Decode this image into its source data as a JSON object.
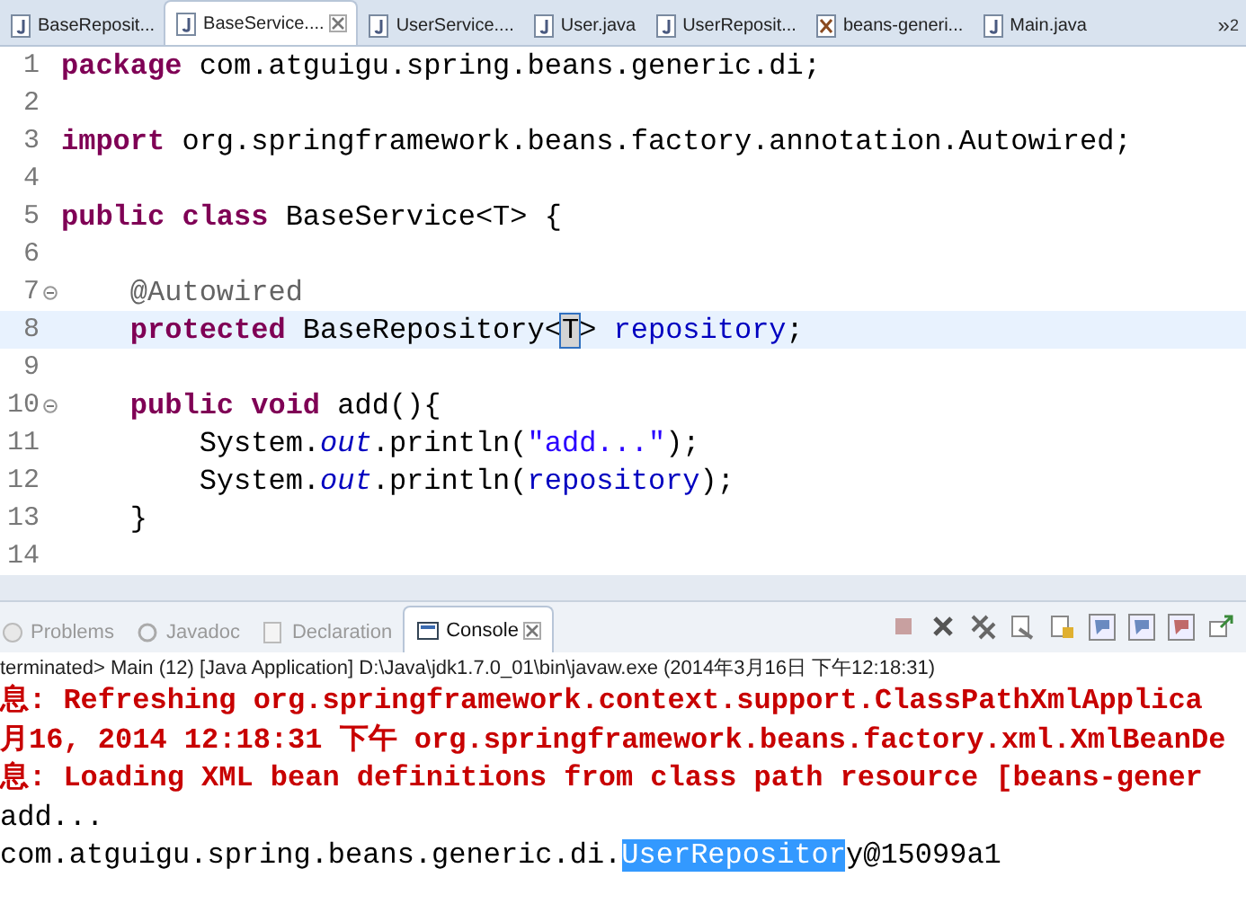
{
  "editor_tabs": [
    {
      "label": "BaseReposit...",
      "selected": false,
      "kind": "java"
    },
    {
      "label": "BaseService....",
      "selected": true,
      "kind": "java"
    },
    {
      "label": "UserService....",
      "selected": false,
      "kind": "java"
    },
    {
      "label": "User.java",
      "selected": false,
      "kind": "java"
    },
    {
      "label": "UserReposit...",
      "selected": false,
      "kind": "java"
    },
    {
      "label": "beans-generi...",
      "selected": false,
      "kind": "xml"
    },
    {
      "label": "Main.java",
      "selected": false,
      "kind": "java"
    }
  ],
  "overflow_tabs": {
    "label": "»",
    "count": "2"
  },
  "code_lines": [
    {
      "number": "1",
      "foldable": false,
      "current": false,
      "tokens": [
        {
          "text": "package",
          "kind": "keyword"
        },
        {
          "text": " com.atguigu.spring.beans.generic.di;",
          "kind": "plain"
        }
      ]
    },
    {
      "number": "2",
      "foldable": false,
      "current": false
    },
    {
      "number": "3",
      "foldable": false,
      "current": false,
      "tokens": [
        {
          "text": "import",
          "kind": "keyword"
        },
        {
          "text": " org.springframework.beans.factory.annotation.Autowired;",
          "kind": "plain"
        }
      ]
    },
    {
      "number": "4",
      "foldable": false,
      "current": false
    },
    {
      "number": "5",
      "foldable": false,
      "current": false,
      "tokens": [
        {
          "text": "public class",
          "kind": "keyword"
        },
        {
          "text": " BaseService<T> {",
          "kind": "plain"
        }
      ]
    },
    {
      "number": "6",
      "foldable": false,
      "current": false
    },
    {
      "number": "7",
      "foldable": true,
      "current": false,
      "tokens": [
        {
          "text": "    @Autowired",
          "kind": "annotation"
        }
      ]
    },
    {
      "number": "8",
      "foldable": false,
      "current": true,
      "tokens": [
        {
          "text": "    protected",
          "kind": "keyword"
        },
        {
          "text": " BaseRepository<",
          "kind": "plain"
        },
        {
          "text": "T",
          "kind": "occurrence"
        },
        {
          "text": "> ",
          "kind": "plain"
        },
        {
          "text": "repository",
          "kind": "field"
        },
        {
          "text": ";",
          "kind": "plain"
        }
      ]
    },
    {
      "number": "9",
      "foldable": false,
      "current": false
    },
    {
      "number": "10",
      "foldable": true,
      "current": false,
      "tokens": [
        {
          "text": "    public void",
          "kind": "keyword"
        },
        {
          "text": " add(){",
          "kind": "plain"
        }
      ]
    },
    {
      "number": "11",
      "foldable": false,
      "current": false,
      "tokens": [
        {
          "text": "        System.",
          "kind": "plain"
        },
        {
          "text": "out",
          "kind": "static"
        },
        {
          "text": ".println(",
          "kind": "plain"
        },
        {
          "text": "\"add...\"",
          "kind": "string"
        },
        {
          "text": ");",
          "kind": "plain"
        }
      ]
    },
    {
      "number": "12",
      "foldable": false,
      "current": false,
      "tokens": [
        {
          "text": "        System.",
          "kind": "plain"
        },
        {
          "text": "out",
          "kind": "static"
        },
        {
          "text": ".println(",
          "kind": "plain"
        },
        {
          "text": "repository",
          "kind": "field"
        },
        {
          "text": ");",
          "kind": "plain"
        }
      ]
    },
    {
      "number": "13",
      "foldable": false,
      "current": false,
      "tokens": [
        {
          "text": "    }",
          "kind": "plain"
        }
      ]
    },
    {
      "number": "14",
      "foldable": false,
      "current": false
    }
  ],
  "panel_tabs": [
    {
      "label": "Problems",
      "selected": false,
      "kind": "problems"
    },
    {
      "label": "Javadoc",
      "selected": false,
      "kind": "javadoc"
    },
    {
      "label": "Declaration",
      "selected": false,
      "kind": "declaration"
    },
    {
      "label": "Console",
      "selected": true,
      "kind": "console"
    }
  ],
  "console_status": "terminated> Main (12) [Java Application] D:\\Java\\jdk1.7.0_01\\bin\\javaw.exe (2014年3月16日 下午12:18:31)",
  "console_lines": [
    {
      "error": true,
      "segments": [
        {
          "text": "息: Refreshing org.springframework.context.support.ClassPathXmlApplica",
          "selected": false
        }
      ]
    },
    {
      "error": true,
      "segments": [
        {
          "text": "月16, 2014 12:18:31 下午 org.springframework.beans.factory.xml.XmlBeanDe",
          "selected": false
        }
      ]
    },
    {
      "error": true,
      "segments": [
        {
          "text": "息: Loading XML bean definitions from class path resource [beans-gener",
          "selected": false
        }
      ]
    },
    {
      "error": false,
      "segments": [
        {
          "text": "add...",
          "selected": false
        }
      ]
    },
    {
      "error": false,
      "segments": [
        {
          "text": "com.atguigu.spring.beans.generic.di.",
          "selected": false
        },
        {
          "text": "UserRepositor",
          "selected": true
        },
        {
          "text": "y@15099a1",
          "selected": false
        }
      ]
    }
  ]
}
